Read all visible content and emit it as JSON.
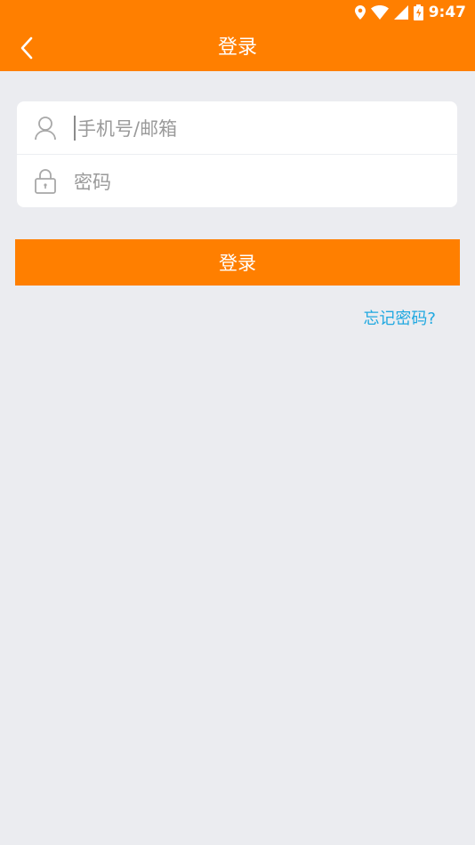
{
  "status_bar": {
    "time": "9:47"
  },
  "header": {
    "title": "登录"
  },
  "form": {
    "account_placeholder": "手机号/邮箱",
    "password_placeholder": "密码"
  },
  "actions": {
    "login_label": "登录",
    "forgot_label": "忘记密码?"
  },
  "colors": {
    "primary": "#ff7f00",
    "background": "#ebecf0",
    "link": "#20a8e0"
  }
}
